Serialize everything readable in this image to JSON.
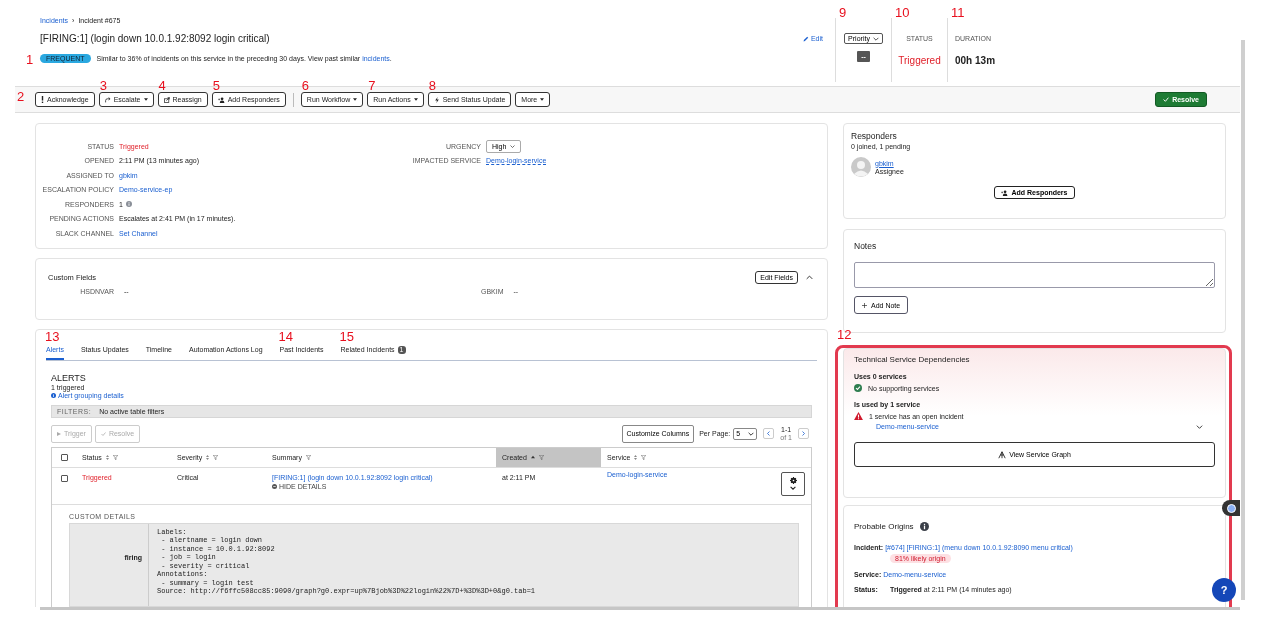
{
  "breadcrumb": {
    "separator": "›",
    "items": [
      {
        "label": "Incidents",
        "link": true
      },
      {
        "label": "Incident #675",
        "link": false
      }
    ]
  },
  "title": "[FIRING:1] (login down 10.0.1.92:8092 login critical)",
  "edit_link": "Edit",
  "frequency": {
    "annotation": "1",
    "badge": "FREQUENT",
    "text": "Similar to 36% of incidents on this service in the preceding 30 days. View past similar ",
    "link": "incidents",
    "end": "."
  },
  "stats": [
    {
      "kind": "priority",
      "annotation": "9",
      "control": "Priority",
      "value": "--"
    },
    {
      "kind": "status",
      "annotation": "10",
      "label": "STATUS",
      "value": "Triggered"
    },
    {
      "kind": "duration",
      "annotation": "11",
      "label": "DURATION",
      "value": "00h 13m"
    }
  ],
  "toolbar": {
    "annotation": "2",
    "groups": [
      [
        {
          "label": "Acknowledge",
          "dropdown": false
        },
        {
          "label": "Escalate",
          "dropdown": true,
          "annotation": "3"
        },
        {
          "label": "Reassign",
          "dropdown": false,
          "annotation": "4"
        },
        {
          "label": "Add Responders",
          "dropdown": false,
          "annotation": "5"
        }
      ],
      [
        {
          "label": "Run Workflow",
          "dropdown": true,
          "annotation": "6"
        },
        {
          "label": "Run Actions",
          "dropdown": true,
          "annotation": "7"
        },
        {
          "label": "Send Status Update",
          "dropdown": false,
          "annotation": "8"
        },
        {
          "label": "More",
          "dropdown": true
        }
      ]
    ],
    "resolve": "Resolve"
  },
  "details": {
    "left": [
      {
        "label": "STATUS",
        "value": "Triggered",
        "kind": "status"
      },
      {
        "label": "OPENED",
        "value": "2:11 PM (13 minutes ago)",
        "kind": "text"
      },
      {
        "label": "ASSIGNED TO",
        "value": "gbkim",
        "kind": "link"
      },
      {
        "label": "ESCALATION POLICY",
        "value": "Demo-service-ep",
        "kind": "link"
      },
      {
        "label": "RESPONDERS",
        "value": "1",
        "kind": "count"
      },
      {
        "label": "PENDING ACTIONS",
        "value": "Escalates at 2:41 PM (in 17 minutes).",
        "kind": "text"
      },
      {
        "label": "SLACK CHANNEL",
        "value": "Set Channel",
        "kind": "link"
      }
    ],
    "right": [
      {
        "label": "URGENCY",
        "value": "High",
        "kind": "select"
      },
      {
        "label": "IMPACTED SERVICE",
        "value": "Demo-login-service",
        "kind": "service"
      }
    ]
  },
  "custom_fields": {
    "title": "Custom Fields",
    "button": "Edit Fields",
    "expanded": true,
    "fields": [
      {
        "label": "HSDNVAR",
        "value": "--"
      },
      {
        "label": "GBKIM",
        "value": "--"
      }
    ]
  },
  "tabs": [
    {
      "label": "Alerts",
      "selected": true,
      "annotation": "13"
    },
    {
      "label": "Status Updates",
      "selected": false
    },
    {
      "label": "Timeline",
      "selected": false
    },
    {
      "label": "Automation Actions Log",
      "selected": false
    },
    {
      "label": "Past Incidents",
      "selected": false,
      "annotation": "14"
    },
    {
      "label": "Related Incidents",
      "selected": false,
      "annotation": "15",
      "badge": "1"
    }
  ],
  "alerts": {
    "title": "ALERTS",
    "count": "1 triggered",
    "grouping_link": "Alert grouping details",
    "filters_label": "FILTERS:",
    "filters_value": "No active table filters",
    "actions": [
      {
        "label": "Trigger",
        "disabled": true
      },
      {
        "label": "Resolve",
        "disabled": true
      }
    ],
    "all_checked": false,
    "customize": "Customize Columns",
    "per_page_label": "Per Page:",
    "per_page": "5",
    "pagination": "1-1",
    "pagination_sub": "of 1",
    "columns": [
      {
        "label": "Status",
        "sortable": true,
        "sorted": false
      },
      {
        "label": "Severity",
        "sortable": true,
        "sorted": false
      },
      {
        "label": "Summary",
        "sortable": false,
        "sorted": false
      },
      {
        "label": "Created",
        "sortable": true,
        "sorted": true
      },
      {
        "label": "Service",
        "sortable": true,
        "sorted": false
      }
    ],
    "rows": [
      {
        "checked": false,
        "status": "Triggered",
        "severity": "Critical",
        "summary": "[FIRING:1] (login down 10.0.1.92:8092 login critical)",
        "toggle": "HIDE DETAILS",
        "created": "at 2:11 PM",
        "service": "Demo-login-service"
      }
    ],
    "custom_details": {
      "label": "CUSTOM DETAILS",
      "key": "firing",
      "lines": [
        "Labels:",
        " - alertname = login down",
        " - instance = 10.0.1.92:8092",
        " - job = login",
        " - severity = critical",
        "Annotations:",
        " - summary = login test",
        "Source: http://f6ffc508cc85:9090/graph?g0.expr=up%7Bjob%3D%22login%22%7D+%3D%3D+0&g0.tab=1"
      ]
    }
  },
  "responders": {
    "title": "Responders",
    "summary": "0 joined, 1 pending",
    "people": [
      {
        "name": "gbkim",
        "role": "Assignee"
      }
    ],
    "button": "Add Responders"
  },
  "notes": {
    "title": "Notes",
    "button": "Add Note"
  },
  "dependencies": {
    "annotation": "12",
    "highlight": true,
    "title": "Technical Service Dependencies",
    "uses_heading": "Uses 0 services",
    "uses_status": "No supporting services",
    "used_heading": "Is used by 1 service",
    "used_status": "1 service has an open incident",
    "service": "Demo-menu-service",
    "expanded": false,
    "button": "View Service Graph"
  },
  "origins": {
    "title": "Probable Origins",
    "incident_label": "Incident:",
    "incident": "[#674] [FIRING:1] (menu down 10.0.1.92:8090 menu critical)",
    "likelihood": "81% likely origin",
    "service_label": "Service:",
    "service": "Demo-menu-service",
    "status_label": "Status:",
    "status": "**Triggered** at 2:11 PM (14 minutes ago)"
  },
  "help_button": "?"
}
